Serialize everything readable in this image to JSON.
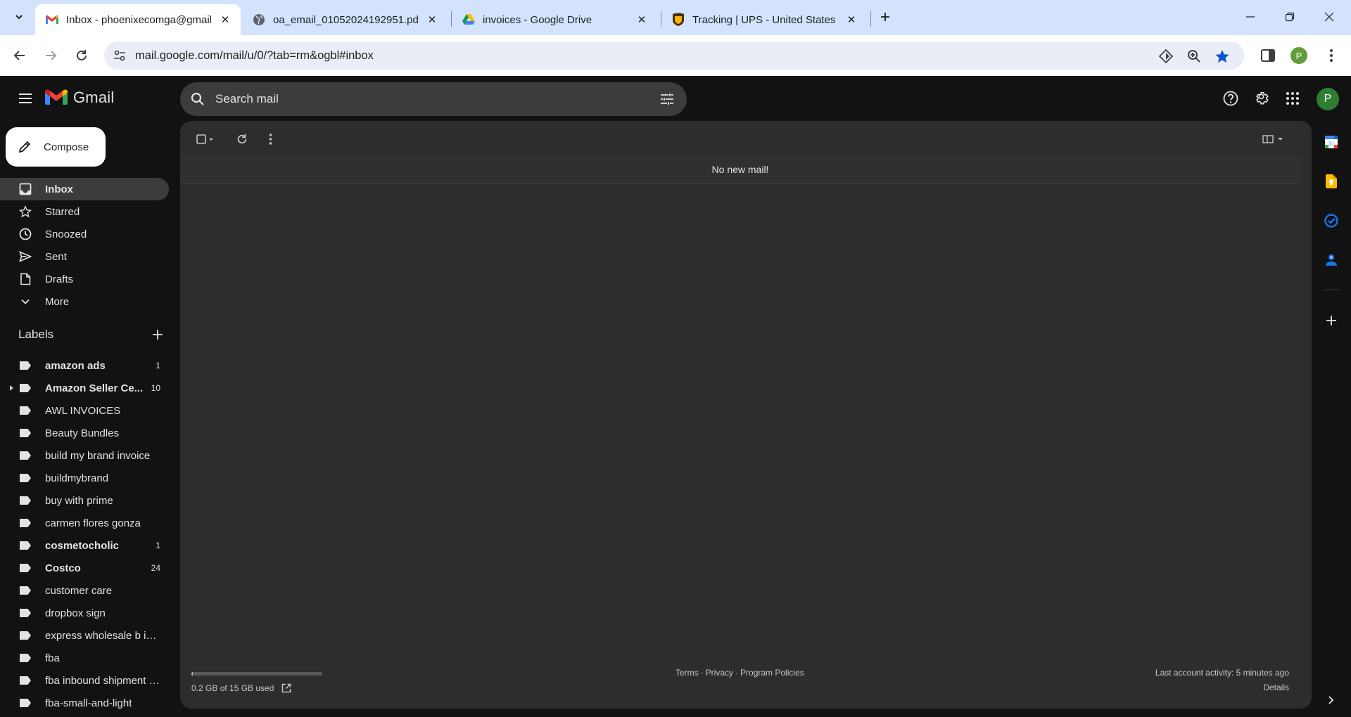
{
  "browser": {
    "tabs": [
      {
        "title": "Inbox - phoenixecomga@gmail",
        "favicon": "gmail-icon",
        "active": true
      },
      {
        "title": "oa_email_01052024192951.pdf",
        "favicon": "globe-icon",
        "active": false
      },
      {
        "title": "invoices - Google Drive",
        "favicon": "google-drive-icon",
        "active": false
      },
      {
        "title": "Tracking | UPS - United States",
        "favicon": "ups-icon",
        "active": false
      }
    ],
    "url": "mail.google.com/mail/u/0/?tab=rm&ogbl#inbox",
    "profile_initial": "P"
  },
  "gmail": {
    "logo_text": "Gmail",
    "search_placeholder": "Search mail",
    "account_initial": "P",
    "compose_label": "Compose",
    "nav": [
      {
        "label": "Inbox",
        "icon": "inbox-icon",
        "active": true
      },
      {
        "label": "Starred",
        "icon": "star-icon"
      },
      {
        "label": "Snoozed",
        "icon": "clock-icon"
      },
      {
        "label": "Sent",
        "icon": "send-icon"
      },
      {
        "label": "Drafts",
        "icon": "draft-icon"
      },
      {
        "label": "More",
        "icon": "chevron-down-icon"
      }
    ],
    "labels_title": "Labels",
    "labels": [
      {
        "name": "amazon ads",
        "count": "1",
        "bold": true
      },
      {
        "name": "Amazon Seller Ce...",
        "count": "10",
        "bold": true,
        "expandable": true
      },
      {
        "name": "AWL INVOICES",
        "count": ""
      },
      {
        "name": "Beauty Bundles",
        "count": ""
      },
      {
        "name": "build my brand invoice",
        "count": ""
      },
      {
        "name": "buildmybrand",
        "count": ""
      },
      {
        "name": "buy with prime",
        "count": ""
      },
      {
        "name": "carmen flores gonza",
        "count": ""
      },
      {
        "name": "cosmetocholic",
        "count": "1",
        "bold": true
      },
      {
        "name": "Costco",
        "count": "24",
        "bold": true
      },
      {
        "name": "customer care",
        "count": ""
      },
      {
        "name": "dropbox sign",
        "count": ""
      },
      {
        "name": "express wholesale b inv...",
        "count": ""
      },
      {
        "name": "fba",
        "count": ""
      },
      {
        "name": "fba inbound shipment b...",
        "count": ""
      },
      {
        "name": "fba-small-and-light",
        "count": ""
      }
    ],
    "empty_message": "No new mail!",
    "storage": {
      "text": "0.2 GB of 15 GB used",
      "used_fraction": 0.013
    },
    "footer_links": [
      "Terms",
      "Privacy",
      "Program Policies"
    ],
    "footer_separator": "·",
    "last_activity": "Last account activity: 5 minutes ago",
    "details_label": "Details"
  },
  "colors": {
    "tabstrip": "#d3e3fd",
    "gmail_bg": "#121212",
    "panel_bg": "#2d2d2d",
    "active_nav": "#3c3c3c",
    "star_blue": "#0b57d0"
  }
}
